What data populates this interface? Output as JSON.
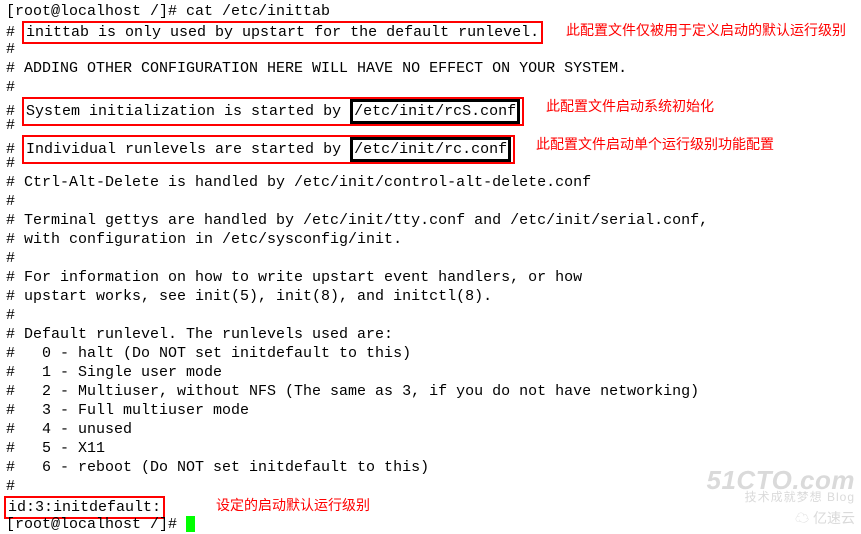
{
  "prompt1": "[root@localhost /]# ",
  "cmd": "cat /etc/inittab",
  "h1": "# ",
  "h1b": "inittab is only used by upstart for the default runlevel.",
  "a1": "此配置文件仅被用于定义启动的默认运行级别",
  "l3": "#",
  "l4": "# ADDING OTHER CONFIGURATION HERE WILL HAVE NO EFFECT ON YOUR SYSTEM.",
  "l5": "#",
  "h2a": "# ",
  "h2b": "System initialization is started by ",
  "h2c": "/etc/init/rcS.conf",
  "a2": "此配置文件启动系统初始化",
  "l7": "#",
  "h3a": "# ",
  "h3b": "Individual runlevels are started by ",
  "h3c": "/etc/init/rc.conf",
  "a3": "此配置文件启动单个运行级别功能配置",
  "l9": "#",
  "l10": "# Ctrl-Alt-Delete is handled by /etc/init/control-alt-delete.conf",
  "l11": "#",
  "l12": "# Terminal gettys are handled by /etc/init/tty.conf and /etc/init/serial.conf,",
  "l13": "# with configuration in /etc/sysconfig/init.",
  "l14": "#",
  "l15": "# For information on how to write upstart event handlers, or how",
  "l16": "# upstart works, see init(5), init(8), and initctl(8).",
  "l17": "#",
  "l18": "# Default runlevel. The runlevels used are:",
  "l19": "#   0 - halt (Do NOT set initdefault to this)",
  "l20": "#   1 - Single user mode",
  "l21": "#   2 - Multiuser, without NFS (The same as 3, if you do not have networking)",
  "l22": "#   3 - Full multiuser mode",
  "l23": "#   4 - unused",
  "l24": "#   5 - X11",
  "l25": "#   6 - reboot (Do NOT set initdefault to this)",
  "l26": "#",
  "h4": "id:3:initdefault:",
  "a4": "设定的启动默认运行级别",
  "prompt2": "[root@localhost /]# ",
  "wm1": "51CTO.com",
  "wm2": "技术成就梦想   Blog",
  "wm3": "☁ 亿速云"
}
